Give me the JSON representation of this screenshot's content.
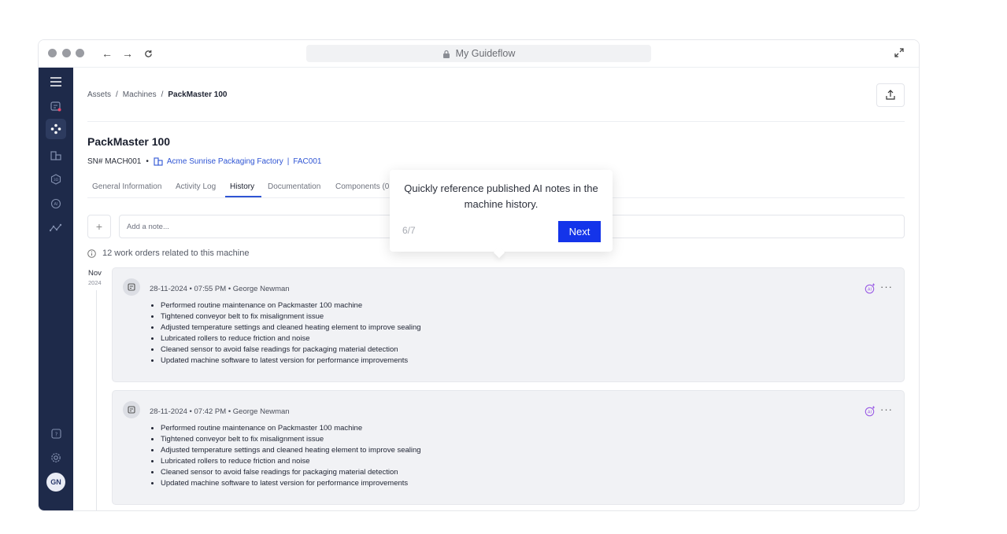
{
  "browser": {
    "url_title": "My Guideflow"
  },
  "sidebar": {
    "items": [
      {
        "icon": "menu-icon"
      },
      {
        "icon": "notifications-icon"
      },
      {
        "icon": "workflow-icon"
      },
      {
        "icon": "building-icon"
      },
      {
        "icon": "3d-icon"
      },
      {
        "icon": "ai-icon"
      },
      {
        "icon": "analytics-icon"
      }
    ],
    "help_icon": "help-icon",
    "settings_icon": "settings-icon",
    "avatar_initials": "GN"
  },
  "breadcrumb": {
    "items": [
      "Assets",
      "Machines",
      "PackMaster 100"
    ],
    "separator": "/"
  },
  "machine": {
    "title": "PackMaster 100",
    "serial": "SN# MACH001",
    "site": "Acme Sunrise Packaging Factory",
    "site_code": "FAC001",
    "site_sep": "|"
  },
  "tabs": [
    {
      "label": "General Information",
      "active": false
    },
    {
      "label": "Activity Log",
      "active": false
    },
    {
      "label": "History",
      "active": true
    },
    {
      "label": "Documentation",
      "active": false
    },
    {
      "label": "Components (0",
      "active": false
    }
  ],
  "note_input": {
    "placeholder": "Add a note...",
    "add_label": "+"
  },
  "work_orders_info": "12 work orders related to this machine",
  "timeline": {
    "month": "Nov",
    "year": "2024"
  },
  "entries": [
    {
      "date": "28-11-2024",
      "time": "07:55 PM",
      "author": "George Newman",
      "notes": [
        "Performed routine maintenance on Packmaster 100 machine",
        "Tightened conveyor belt to fix misalignment issue",
        "Adjusted temperature settings and cleaned heating element to improve sealing",
        "Lubricated rollers to reduce friction and noise",
        "Cleaned sensor to avoid false readings for packaging material detection",
        "Updated machine software to latest version for performance improvements"
      ]
    },
    {
      "date": "28-11-2024",
      "time": "07:42 PM",
      "author": "George Newman",
      "notes": [
        "Performed routine maintenance on Packmaster 100 machine",
        "Tightened conveyor belt to fix misalignment issue",
        "Adjusted temperature settings and cleaned heating element to improve sealing",
        "Lubricated rollers to reduce friction and noise",
        "Cleaned sensor to avoid false readings for packaging material detection",
        "Updated machine software to latest version for performance improvements"
      ]
    }
  ],
  "tooltip": {
    "text": "Quickly reference published AI notes in the machine history.",
    "step": "6/7",
    "next_label": "Next"
  },
  "colors": {
    "sidebar": "#1e2a4a",
    "accent": "#2f55d4",
    "next_button": "#1434ea",
    "ai_purple": "#9b5de5"
  }
}
